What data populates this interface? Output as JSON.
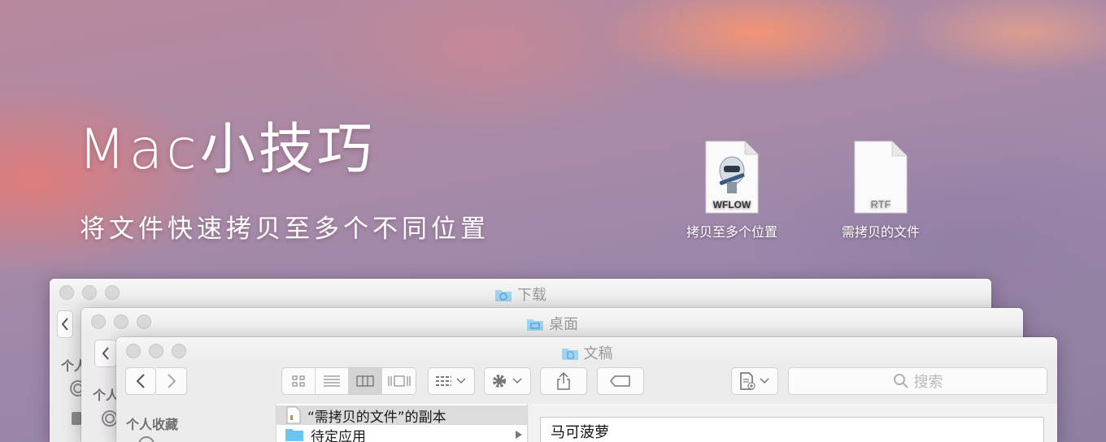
{
  "hero": {
    "title": "Mac小技巧",
    "subtitle": "将文件快速拷贝至多个不同位置"
  },
  "desktop_icons": [
    {
      "label": "拷贝至多个位置",
      "badge": "WFLOW",
      "icon": "automator-workflow-icon"
    },
    {
      "label": "需拷贝的文件",
      "badge": "RTF",
      "icon": "rtf-document-icon"
    }
  ],
  "windows": {
    "back": {
      "title": "下载"
    },
    "middle": {
      "title": "桌面",
      "sidebar_head_partial": "个人"
    },
    "front": {
      "title": "文稿",
      "search_placeholder": "搜索",
      "sidebar_head": "个人收藏",
      "files": [
        {
          "name": "“需拷贝的文件”的副本",
          "kind": "rtf",
          "selected": true
        },
        {
          "name": "待定应用",
          "kind": "folder",
          "selected": false
        }
      ],
      "preview_text": "马可菠萝"
    },
    "back_sidebar_head_partial": "个人"
  },
  "colors": {
    "window_bg": "#ececec",
    "folder_blue": "#6cc4f2",
    "selection": "#dcdcdc"
  }
}
